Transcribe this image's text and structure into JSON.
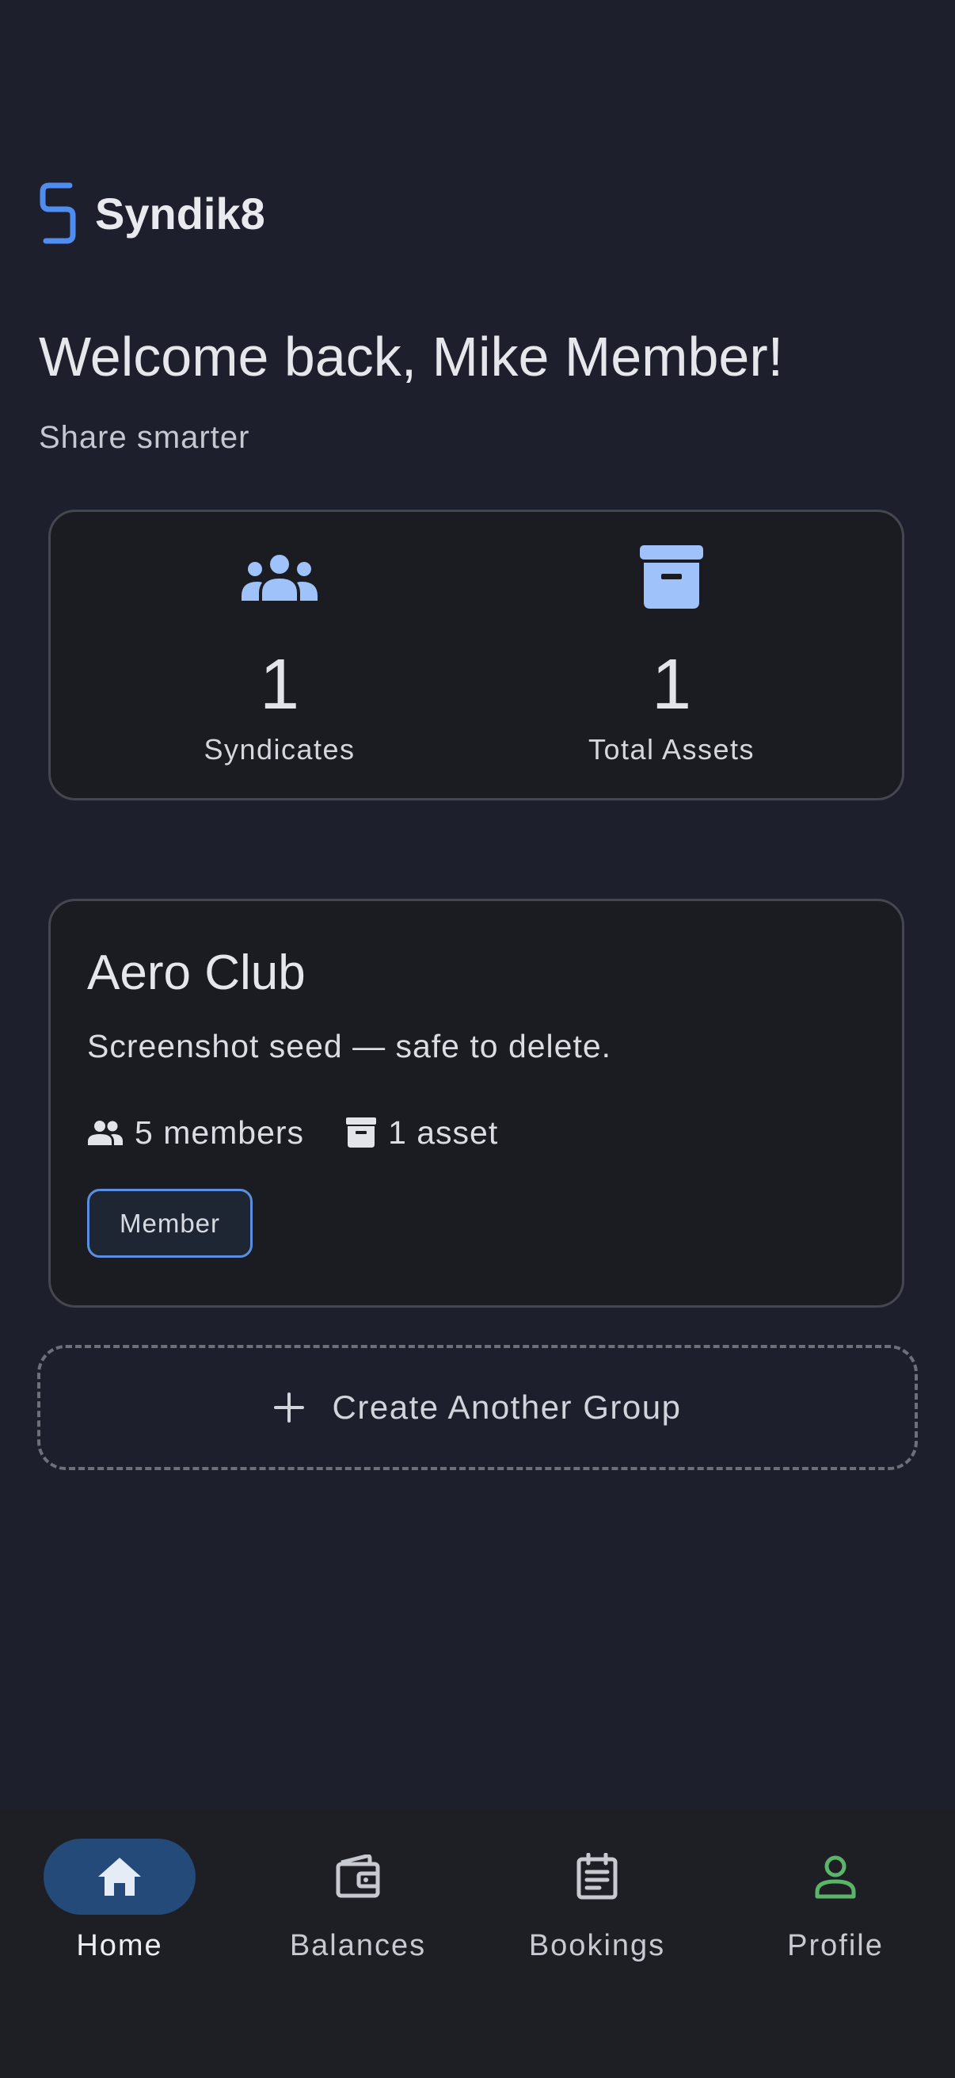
{
  "app": {
    "name": "Syndik8"
  },
  "header": {
    "welcome": "Welcome back, Mike Member!",
    "tagline": "Share smarter"
  },
  "stats": {
    "syndicates": {
      "value": "1",
      "label": "Syndicates",
      "icon": "groups-icon"
    },
    "assets": {
      "value": "1",
      "label": "Total Assets",
      "icon": "archive-box-icon"
    }
  },
  "groups": [
    {
      "name": "Aero Club",
      "description": "Screenshot seed — safe to delete.",
      "members": "5 members",
      "assets": "1 asset",
      "role": "Member"
    }
  ],
  "actions": {
    "create_group": "Create Another Group"
  },
  "nav": {
    "items": [
      {
        "label": "Home",
        "icon": "home-icon",
        "active": true
      },
      {
        "label": "Balances",
        "icon": "wallet-icon",
        "active": false
      },
      {
        "label": "Bookings",
        "icon": "bookings-icon",
        "active": false
      },
      {
        "label": "Profile",
        "icon": "profile-icon",
        "active": false
      }
    ]
  },
  "colors": {
    "background": "#1d202c",
    "card": "#1b1c21",
    "accent": "#9ec2f9",
    "logo": "#4f8ef0",
    "active_nav": "#234a78",
    "profile_icon": "#5cb46a",
    "badge_border": "#5b8ee0"
  }
}
